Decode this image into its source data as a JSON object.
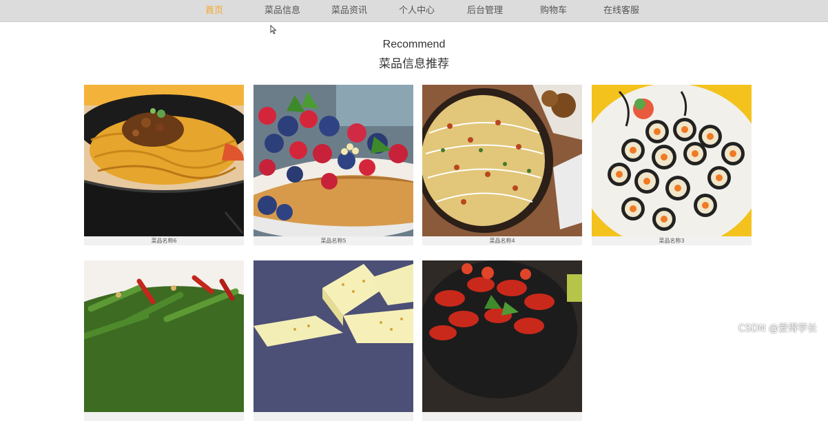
{
  "nav": {
    "items": [
      "首页",
      "菜品信息",
      "菜品资讯",
      "个人中心",
      "后台管理",
      "购物车",
      "在线客服"
    ]
  },
  "header": {
    "en": "Recommend",
    "cn": "菜品信息推荐"
  },
  "dishes": [
    {
      "name": "菜品名称6"
    },
    {
      "name": "菜品名称5"
    },
    {
      "name": "菜品名称4"
    },
    {
      "name": "菜品名称3"
    },
    {
      "name": ""
    },
    {
      "name": ""
    },
    {
      "name": ""
    }
  ],
  "watermark": "CSDN @爱得学长",
  "colors": {
    "accent": "#f5a623",
    "nav_bg": "#dcdcdc"
  }
}
